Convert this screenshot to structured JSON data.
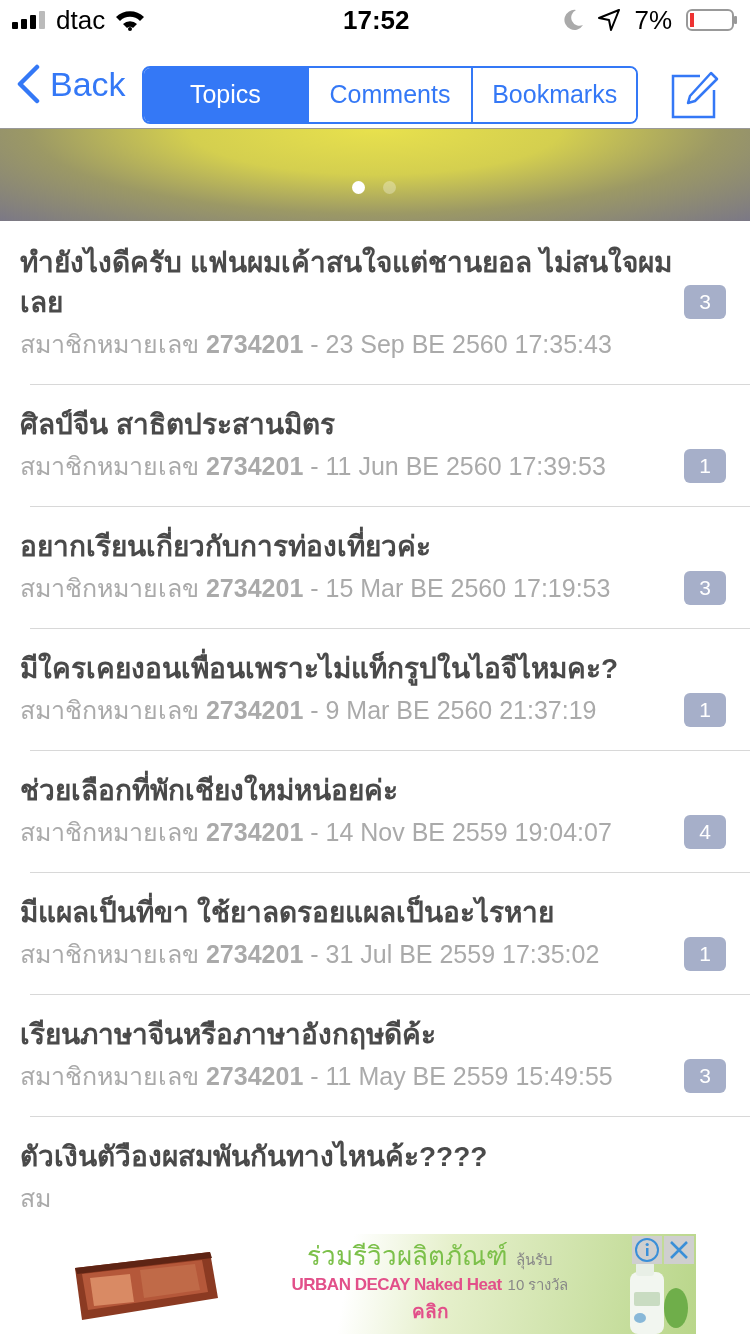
{
  "status_bar": {
    "carrier": "dtac",
    "time": "17:52",
    "battery": "7%"
  },
  "nav": {
    "back": "Back",
    "segments": [
      {
        "label": "Topics",
        "selected": true
      },
      {
        "label": "Comments",
        "selected": false
      },
      {
        "label": "Bookmarks",
        "selected": false
      }
    ]
  },
  "banner": {
    "pages": [
      {
        "selected": true
      },
      {
        "selected": false
      }
    ]
  },
  "topics": [
    {
      "title": "ทำยังไงดีครับ แฟนผมเค้าสนใจแต่ชานยอล ไม่สนใจผมเลย",
      "meta": "สมาชิกหมายเลข **2734201** - 23 Sep BE 2560 17:35:43",
      "count": "3"
    },
    {
      "title": "ศิลป์จีน สาธิตประสานมิตร",
      "meta": "สมาชิกหมายเลข **2734201** - 11 Jun BE 2560 17:39:53",
      "count": "1"
    },
    {
      "title": "อยากเรียนเกี่ยวกับการท่องเที่ยวค่ะ",
      "meta": "สมาชิกหมายเลข **2734201** - 15 Mar BE 2560 17:19:53",
      "count": "3"
    },
    {
      "title": "มีใครเคยงอนเพื่อนเพราะไม่แท็กรูปในไอจีไหมคะ?",
      "meta": "สมาชิกหมายเลข **2734201** - 9 Mar BE 2560 21:37:19",
      "count": "1"
    },
    {
      "title": "ช่วยเลือกที่พักเชียงใหม่หน่อยค่ะ",
      "meta": "สมาชิกหมายเลข **2734201** - 14 Nov BE 2559 19:04:07",
      "count": "4"
    },
    {
      "title": "มีแผลเป็นที่ขา ใช้ยาลดรอยแผลเป็นอะไรหาย",
      "meta": "สมาชิกหมายเลข **2734201** - 31 Jul BE 2559 17:35:02",
      "count": "1"
    },
    {
      "title": "เรียนภาษาจีนหรือภาษาอังกฤษดีค้ะ",
      "meta": "สมาชิกหมายเลข **2734201** - 11 May BE 2559 15:49:55",
      "count": "3"
    },
    {
      "title": "ตัวเงินตัวืองผสมพันกันทางไหนค้ะ????",
      "meta": "สม"
    }
  ],
  "ad": {
    "headline": "ร่วมรีวิวผลิตภัณฑ์",
    "headline_note": "ลุ้นรับ",
    "product": "URBAN DECAY Naked Heat",
    "prize": "10 รางวัล",
    "cta": "คลิก"
  }
}
